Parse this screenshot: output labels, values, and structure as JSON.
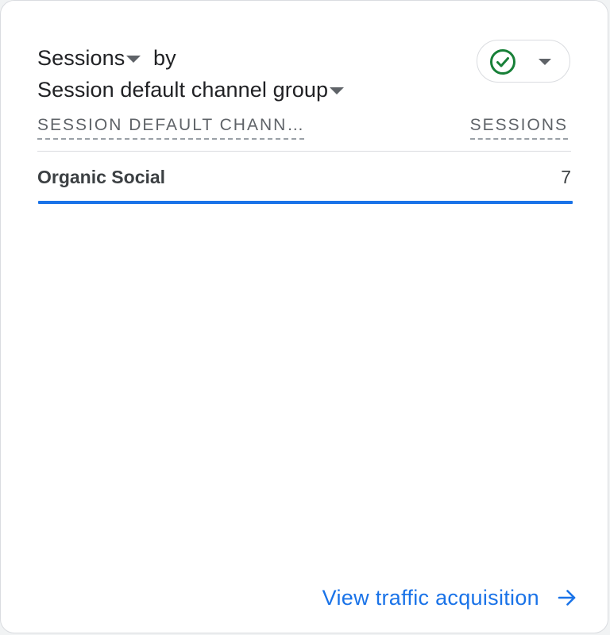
{
  "card": {
    "title": {
      "metric_label": "Sessions",
      "by_label": "by",
      "dimension_label": "Session default channel group"
    },
    "status_icon": "check-circle-icon",
    "colors": {
      "accent": "#1a73e8",
      "status_ok": "#188038",
      "text": "#202124",
      "muted": "#5f6368"
    },
    "table": {
      "columns": {
        "dimension": "SESSION DEFAULT CHANN…",
        "metric": "SESSIONS"
      },
      "rows": [
        {
          "label": "Organic Social",
          "value": "7",
          "share": 1.0
        }
      ]
    },
    "footer": {
      "link_label": "View traffic acquisition",
      "link_icon": "arrow-right-icon"
    }
  }
}
